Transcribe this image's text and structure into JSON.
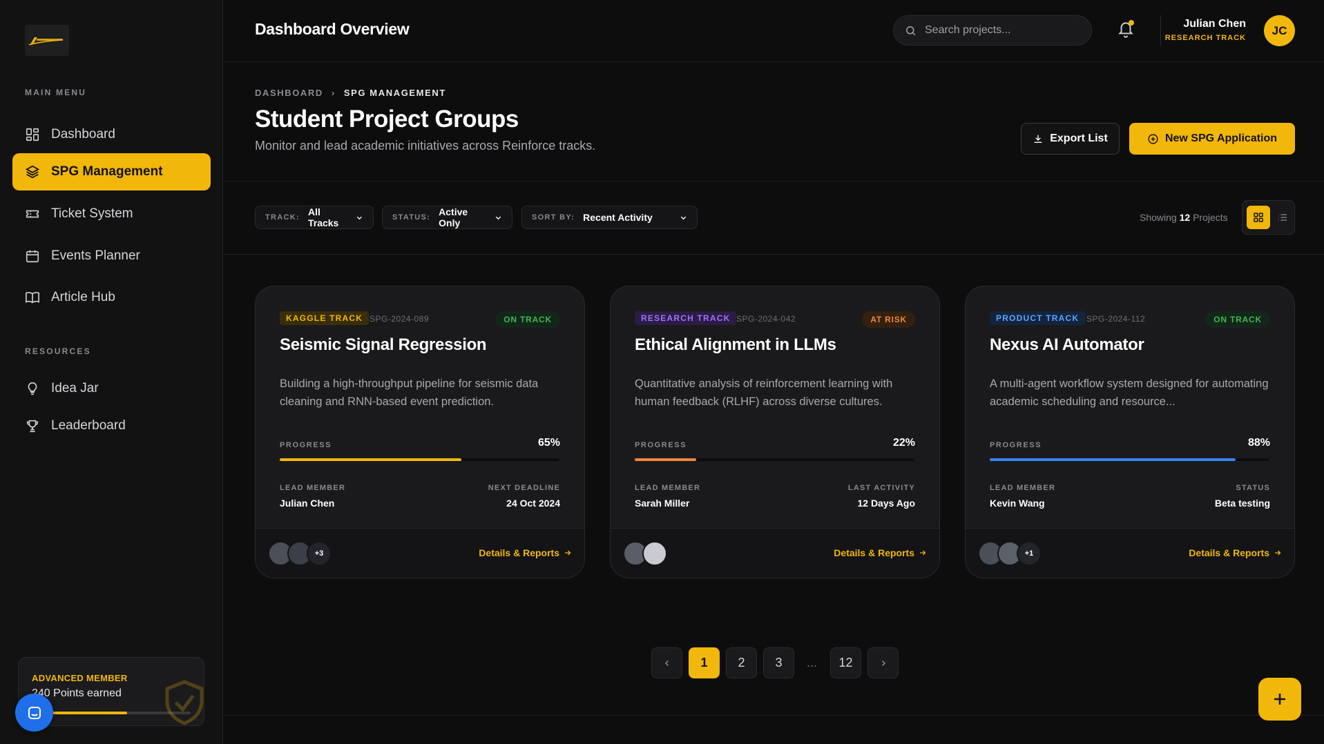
{
  "sidebar": {
    "logo_alt": "Reinforce",
    "main_menu_label": "MAIN MENU",
    "main_items": [
      {
        "label": "Dashboard",
        "icon": "grid-icon"
      },
      {
        "label": "SPG Management",
        "icon": "layers-icon",
        "active": true
      },
      {
        "label": "Ticket System",
        "icon": "ticket-icon"
      },
      {
        "label": "Events Planner",
        "icon": "calendar-icon"
      },
      {
        "label": "Article Hub",
        "icon": "book-icon"
      }
    ],
    "resources_label": "RESOURCES",
    "resource_items": [
      {
        "label": "Idea Jar",
        "icon": "lightbulb-icon"
      },
      {
        "label": "Leaderboard",
        "icon": "trophy-icon"
      }
    ],
    "member_card": {
      "tier": "ADVANCED MEMBER",
      "points": "240 Points earned",
      "progress": 0.6
    }
  },
  "header": {
    "title": "Dashboard Overview",
    "search_placeholder": "Search projects...",
    "user_name": "Julian Chen",
    "user_role": "RESEARCH TRACK",
    "user_initials": "JC"
  },
  "page": {
    "breadcrumb": [
      "DASHBOARD",
      "SPG MANAGEMENT"
    ],
    "title": "Student Project Groups",
    "subtitle": "Monitor and lead academic initiatives across Reinforce tracks.",
    "export_label": "Export List",
    "new_label": "New SPG Application"
  },
  "filters": [
    {
      "label": "TRACK:",
      "value": "All Tracks"
    },
    {
      "label": "STATUS:",
      "value": "Active Only"
    },
    {
      "label": "SORT BY:",
      "value": "Recent Activity"
    }
  ],
  "showing": {
    "prefix": "Showing",
    "count": "12",
    "suffix": "Projects"
  },
  "cards": [
    {
      "track": "KAGGLE TRACK",
      "track_color": "#f2b70b",
      "track_bg": "#3a2e0a",
      "code": "SPG-2024-089",
      "status": "ON TRACK",
      "status_color": "#3fb950",
      "status_bg": "#12261a",
      "title": "Seismic Signal Regression",
      "desc": "Building a high-throughput pipeline for seismic data cleaning and RNN-based event prediction.",
      "progress_label": "PROGRESS",
      "progress": "65%",
      "progress_value": 0.65,
      "bar_color": "#f2b70b",
      "left_label": "LEAD MEMBER",
      "left_value": "Julian Chen",
      "right_label": "NEXT DEADLINE",
      "right_value": "24 Oct 2024",
      "avatars": [
        "#4b4f58",
        "#3b3f48"
      ],
      "extra": "+3",
      "details": "Details & Reports"
    },
    {
      "track": "RESEARCH TRACK",
      "track_color": "#a371f7",
      "track_bg": "#2a1d45",
      "code": "SPG-2024-042",
      "status": "AT RISK",
      "status_color": "#f0883e",
      "status_bg": "#33200f",
      "title": "Ethical Alignment in LLMs",
      "desc": "Quantitative analysis of reinforcement learning with human feedback (RLHF) across diverse cultures.",
      "progress_label": "PROGRESS",
      "progress": "22%",
      "progress_value": 0.22,
      "bar_color": "#f0883e",
      "left_label": "LEAD MEMBER",
      "left_value": "Sarah Miller",
      "right_label": "LAST ACTIVITY",
      "right_value": "12 Days Ago",
      "avatars": [
        "#5a5e66",
        "#c9cbd0"
      ],
      "extra": "",
      "details": "Details & Reports"
    },
    {
      "track": "PRODUCT TRACK",
      "track_color": "#58a6ff",
      "track_bg": "#13243d",
      "code": "SPG-2024-112",
      "status": "ON TRACK",
      "status_color": "#3fb950",
      "status_bg": "#12261a",
      "title": "Nexus AI Automator",
      "desc": "A multi-agent workflow system designed for automating academic scheduling and resource...",
      "progress_label": "PROGRESS",
      "progress": "88%",
      "progress_value": 0.88,
      "bar_color": "#3b82f6",
      "left_label": "LEAD MEMBER",
      "left_value": "Kevin Wang",
      "right_label": "STATUS",
      "right_value": "Beta testing",
      "avatars": [
        "#4b4f58",
        "#5c6069"
      ],
      "extra": "+1",
      "details": "Details & Reports"
    }
  ],
  "pagination": {
    "pages": [
      "1",
      "2",
      "3",
      "...",
      "12"
    ],
    "current": "1"
  }
}
